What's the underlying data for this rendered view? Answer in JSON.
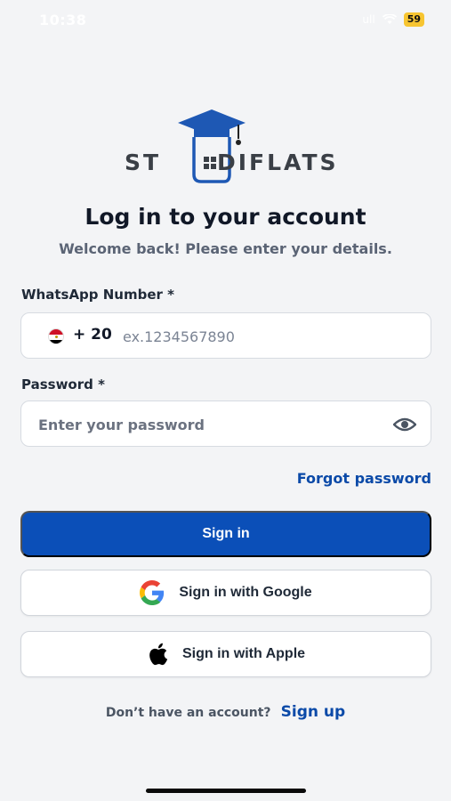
{
  "status_bar": {
    "time": "10:38",
    "signal": "ull",
    "battery": "59"
  },
  "logo": {
    "left_text": "ST",
    "right_text": "DIFLATS",
    "colors": {
      "cap": "#1e58b4",
      "text": "#3a3f46"
    }
  },
  "header": {
    "title": "Log in to your account",
    "subtitle": "Welcome back! Please enter your details."
  },
  "form": {
    "phone_label": "WhatsApp Number *",
    "country_flag": "egypt-flag-icon",
    "dial_code": "+ 20",
    "phone_placeholder": "ex.1234567890",
    "password_label": "Password *",
    "password_placeholder": "Enter your password",
    "forgot_password": "Forgot password"
  },
  "actions": {
    "sign_in": "Sign in",
    "google": "Sign in with Google",
    "apple": "Sign in with Apple"
  },
  "footer": {
    "prompt": "Don’t have an account?",
    "signup": "Sign up"
  },
  "colors": {
    "primary": "#0b4fb8",
    "link": "#0b4aa8",
    "background": "#f3f4f6"
  }
}
